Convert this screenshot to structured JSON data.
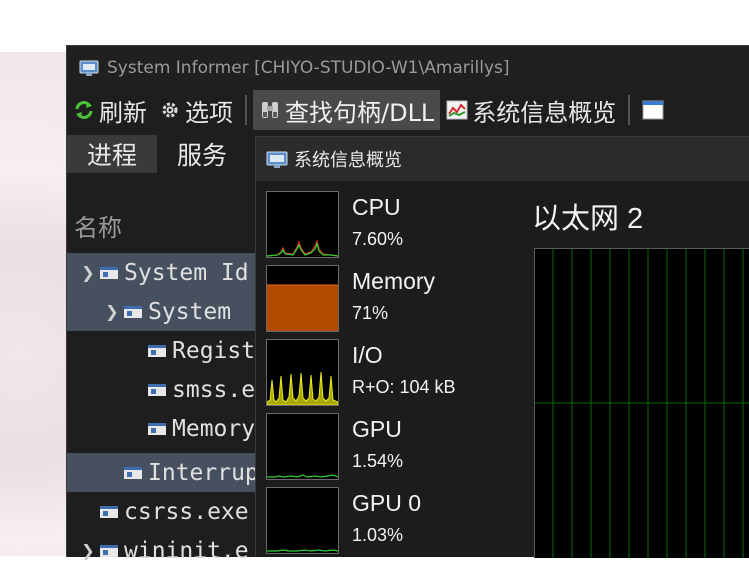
{
  "window": {
    "title": "System Informer [CHIYO-STUDIO-W1\\Amarillys]"
  },
  "toolbar": {
    "refresh_label": "刷新",
    "options_label": "选项",
    "find_label": "查找句柄/DLL",
    "sysinfo_label": "系统信息概览"
  },
  "tabs": [
    {
      "label": "进程"
    },
    {
      "label": "服务"
    }
  ],
  "process_list": {
    "column_header": "名称",
    "rows": [
      {
        "name": "System Id"
      },
      {
        "name": "System"
      },
      {
        "name": "Regist"
      },
      {
        "name": "smss.e"
      },
      {
        "name": "Memory"
      },
      {
        "name": "Interrup"
      },
      {
        "name": "csrss.exe"
      },
      {
        "name": "wininit.e"
      }
    ]
  },
  "sysinfo": {
    "title": "系统信息概览",
    "metrics": [
      {
        "label": "CPU",
        "value": "7.60%",
        "color": "#2fcf2f"
      },
      {
        "label": "Memory",
        "value": "71%",
        "color": "#b24a00"
      },
      {
        "label": "I/O",
        "value": "R+O: 104 kB",
        "color": "#e8e81a"
      },
      {
        "label": "GPU",
        "value": "1.54%",
        "color": "#2fcf2f"
      },
      {
        "label": "GPU 0",
        "value": "1.03%",
        "color": "#2fcf2f"
      }
    ],
    "network": {
      "title": "以太网 2",
      "grid_color": "#0a6a0a"
    }
  },
  "colors": {
    "window_bg": "#1e1e1e",
    "selection": "#46505f",
    "accent_green": "#2fcf2f"
  }
}
